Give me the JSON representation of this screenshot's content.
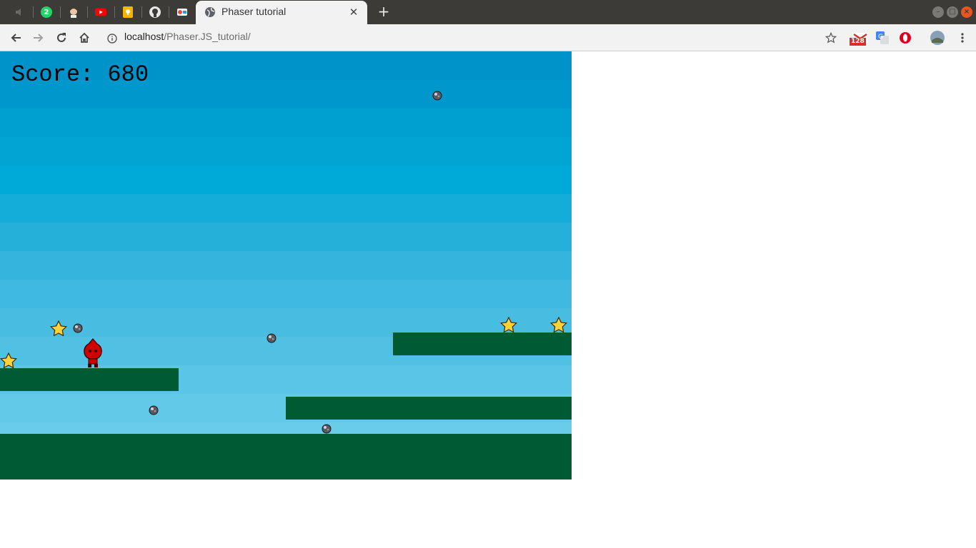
{
  "browser": {
    "tabs": [
      {
        "title": "Phaser tutorial",
        "favicon": "globe-icon",
        "active": true
      }
    ],
    "pinned_tabs": [
      "mute-icon",
      "whatsapp-icon",
      "avatar-icon",
      "youtube-icon",
      "keep-icon",
      "github-icon",
      "game-icon"
    ],
    "whatsapp_badge": "2",
    "address": {
      "host": "localhost",
      "path": "/Phaser.JS_tutorial/"
    },
    "gmail_badge": "128",
    "colors": {
      "tabbar": "#3c3b37",
      "toolbar": "#f2f2f2",
      "close_button": "#e95420"
    }
  },
  "game": {
    "score_label": "Score: 680",
    "colors": {
      "platform": "#005a32",
      "star": "#ffd23a",
      "bomb": "#5a5a62",
      "player": "#d10000"
    },
    "sky_colors": [
      "#0093c9",
      "#0098cc",
      "#00a0d1",
      "#00a5d4",
      "#00aad8",
      "#14acd9",
      "#25b0da",
      "#34b5dd",
      "#3fb9df",
      "#49bde1",
      "#50c1e3",
      "#5ac5e6",
      "#62c9e8",
      "#69cdea",
      "#70d1ec"
    ],
    "sprites": {
      "player": "player-character",
      "star": "star-icon",
      "bomb": "bomb-icon"
    }
  }
}
